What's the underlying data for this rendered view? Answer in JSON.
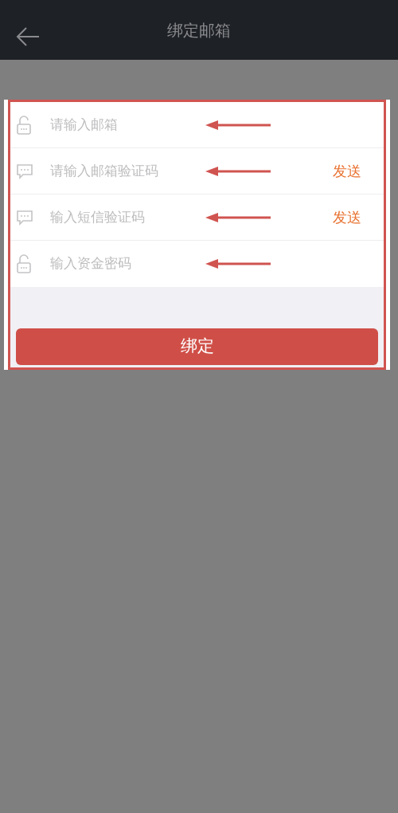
{
  "header": {
    "title": "绑定邮箱"
  },
  "fields": [
    {
      "kind": "lock",
      "placeholder": "请输入邮箱"
    },
    {
      "kind": "message",
      "placeholder": "请输入邮箱验证码",
      "action": "发送"
    },
    {
      "kind": "message",
      "placeholder": "输入短信验证码",
      "action": "发送"
    },
    {
      "kind": "lock",
      "placeholder": "输入资金密码"
    }
  ],
  "submit": {
    "label": "绑定"
  }
}
